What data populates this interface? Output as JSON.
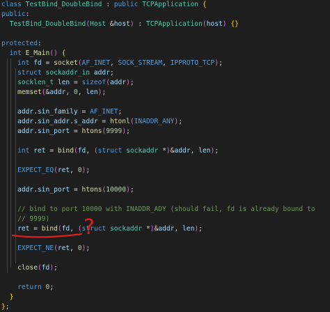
{
  "code_lines": [
    "class TestBind_DoubleBind : public TCPApplication {",
    "public:",
    "  TestBind_DoubleBind(Host &host) : TCPApplication(host) {}",
    "",
    "protected:",
    "  int E_Main() {",
    "    int fd = socket(AF_INET, SOCK_STREAM, IPPROTO_TCP);",
    "    struct sockaddr_in addr;",
    "    socklen_t len = sizeof(addr);",
    "    memset(&addr, 0, len);",
    "",
    "    addr.sin_family = AF_INET;",
    "    addr.sin_addr.s_addr = htonl(INADDR_ANY);",
    "    addr.sin_port = htons(9999);",
    "",
    "    int ret = bind(fd, (struct sockaddr *)&addr, len);",
    "",
    "    EXPECT_EQ(ret, 0);",
    "",
    "    addr.sin_port = htons(10000);",
    "",
    "    // bind to port 10000 with INADDR_ADY (should fail, fd is already bound to",
    "    // 9999)",
    "    ret = bind(fd, (struct sockaddr *)&addr, len);",
    "",
    "    EXPECT_NE(ret, 0);",
    "",
    "    close(fd);",
    "",
    "    return 0;",
    "  }",
    "};"
  ],
  "annotation": {
    "underline_color": "#e02020",
    "question_mark": "?"
  }
}
